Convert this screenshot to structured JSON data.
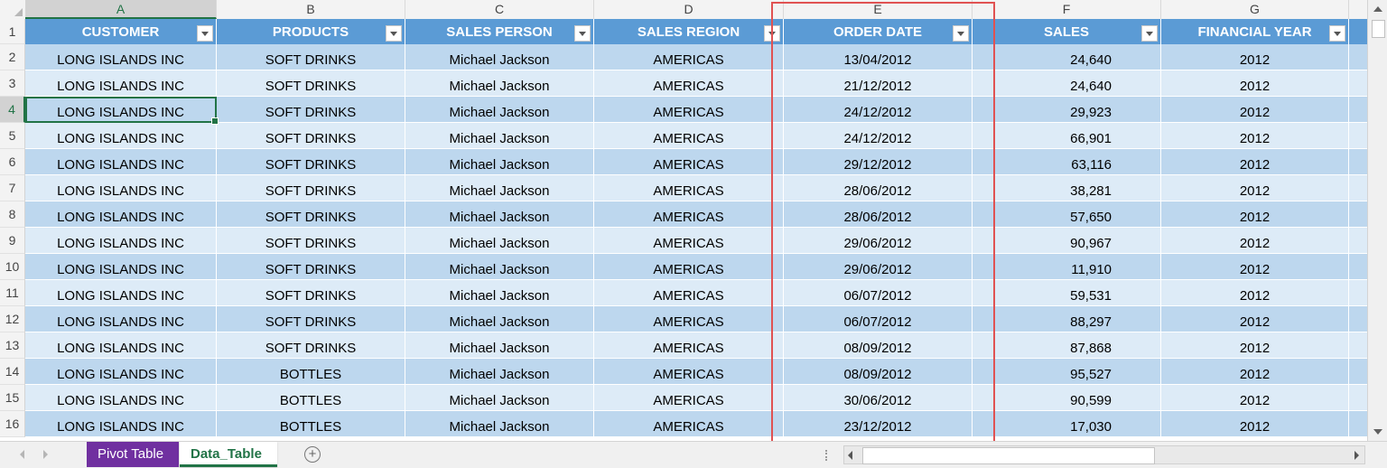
{
  "columns": [
    "A",
    "B",
    "C",
    "D",
    "E",
    "F",
    "G"
  ],
  "active_column": "A",
  "row_numbers": [
    "1",
    "2",
    "3",
    "4",
    "5",
    "6",
    "7",
    "8",
    "9",
    "10",
    "11",
    "12",
    "13",
    "14",
    "15",
    "16"
  ],
  "active_row": "4",
  "table": {
    "headers": [
      "CUSTOMER",
      "PRODUCTS",
      "SALES PERSON",
      "SALES REGION",
      "ORDER DATE",
      "SALES",
      "FINANCIAL YEAR"
    ],
    "rows": [
      [
        "LONG ISLANDS INC",
        "SOFT DRINKS",
        "Michael Jackson",
        "AMERICAS",
        "13/04/2012",
        "24,640",
        "2012"
      ],
      [
        "LONG ISLANDS INC",
        "SOFT DRINKS",
        "Michael Jackson",
        "AMERICAS",
        "21/12/2012",
        "24,640",
        "2012"
      ],
      [
        "LONG ISLANDS INC",
        "SOFT DRINKS",
        "Michael Jackson",
        "AMERICAS",
        "24/12/2012",
        "29,923",
        "2012"
      ],
      [
        "LONG ISLANDS INC",
        "SOFT DRINKS",
        "Michael Jackson",
        "AMERICAS",
        "24/12/2012",
        "66,901",
        "2012"
      ],
      [
        "LONG ISLANDS INC",
        "SOFT DRINKS",
        "Michael Jackson",
        "AMERICAS",
        "29/12/2012",
        "63,116",
        "2012"
      ],
      [
        "LONG ISLANDS INC",
        "SOFT DRINKS",
        "Michael Jackson",
        "AMERICAS",
        "28/06/2012",
        "38,281",
        "2012"
      ],
      [
        "LONG ISLANDS INC",
        "SOFT DRINKS",
        "Michael Jackson",
        "AMERICAS",
        "28/06/2012",
        "57,650",
        "2012"
      ],
      [
        "LONG ISLANDS INC",
        "SOFT DRINKS",
        "Michael Jackson",
        "AMERICAS",
        "29/06/2012",
        "90,967",
        "2012"
      ],
      [
        "LONG ISLANDS INC",
        "SOFT DRINKS",
        "Michael Jackson",
        "AMERICAS",
        "29/06/2012",
        "11,910",
        "2012"
      ],
      [
        "LONG ISLANDS INC",
        "SOFT DRINKS",
        "Michael Jackson",
        "AMERICAS",
        "06/07/2012",
        "59,531",
        "2012"
      ],
      [
        "LONG ISLANDS INC",
        "SOFT DRINKS",
        "Michael Jackson",
        "AMERICAS",
        "06/07/2012",
        "88,297",
        "2012"
      ],
      [
        "LONG ISLANDS INC",
        "SOFT DRINKS",
        "Michael Jackson",
        "AMERICAS",
        "08/09/2012",
        "87,868",
        "2012"
      ],
      [
        "LONG ISLANDS INC",
        "BOTTLES",
        "Michael Jackson",
        "AMERICAS",
        "08/09/2012",
        "95,527",
        "2012"
      ],
      [
        "LONG ISLANDS INC",
        "BOTTLES",
        "Michael Jackson",
        "AMERICAS",
        "30/06/2012",
        "90,599",
        "2012"
      ],
      [
        "LONG ISLANDS INC",
        "BOTTLES",
        "Michael Jackson",
        "AMERICAS",
        "23/12/2012",
        "17,030",
        "2012"
      ]
    ]
  },
  "sheet_tabs": {
    "tabs": [
      {
        "label": "Pivot Table",
        "color": "#7030a0"
      },
      {
        "label": "Data_Table",
        "color": "#217346"
      }
    ],
    "active": "Data_Table",
    "add_label": "+"
  },
  "colors": {
    "table_header": "#5b9bd5",
    "band_dark": "#bdd7ee",
    "band_light": "#ddebf7",
    "selection": "#217346",
    "highlight_box": "#e05252"
  },
  "icons": {
    "filter": "filter-dropdown-icon",
    "scroll_up": "scroll-up-arrow-icon",
    "scroll_down": "scroll-down-arrow-icon",
    "add_sheet": "plus-circle-icon"
  }
}
